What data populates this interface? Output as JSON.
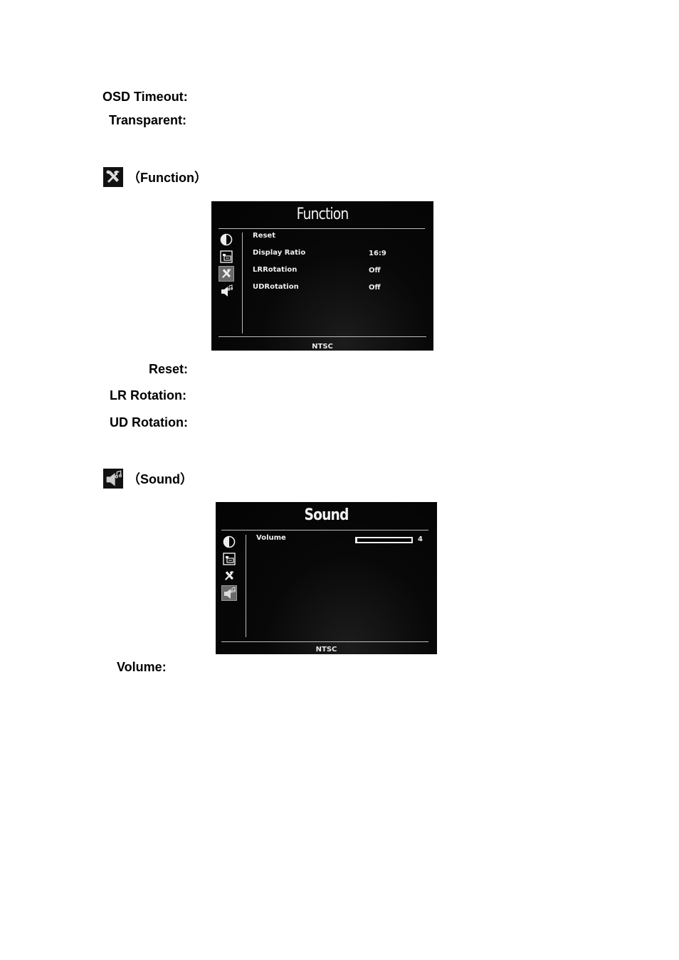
{
  "osd_settings": {
    "items": [
      {
        "label": "OSD Timeout",
        "colon": ":"
      },
      {
        "label": "Transparent",
        "colon": ":"
      }
    ]
  },
  "function_section": {
    "icon": "tools-icon",
    "heading": "（Function）",
    "screen": {
      "title": "Function",
      "sidebar_icons": [
        "contrast-icon",
        "picture-menu-icon",
        "tools-icon",
        "sound-icon"
      ],
      "active_icon": "tools-icon",
      "rows": [
        {
          "label": "Reset",
          "value": ""
        },
        {
          "label": "Display Ratio",
          "value": "16:9"
        },
        {
          "label": "LRRotation",
          "value": "Off"
        },
        {
          "label": "UDRotation",
          "value": "Off"
        }
      ],
      "footer": "NTSC"
    },
    "descriptions": [
      {
        "label": "Reset",
        "colon": ":"
      },
      {
        "label": "LR Rotation",
        "colon": ":"
      },
      {
        "label": "UD Rotation",
        "colon": ":"
      }
    ]
  },
  "sound_section": {
    "icon": "sound-icon",
    "heading": "（Sound）",
    "screen": {
      "title": "Sound",
      "sidebar_icons": [
        "contrast-icon",
        "picture-menu-icon",
        "tools-icon",
        "sound-icon"
      ],
      "active_icon": "sound-icon",
      "rows": [
        {
          "label": "Volume",
          "value": "4",
          "level_percent": 4
        }
      ],
      "footer": "NTSC"
    },
    "descriptions": [
      {
        "label": "Volume",
        "colon": ":"
      }
    ]
  }
}
